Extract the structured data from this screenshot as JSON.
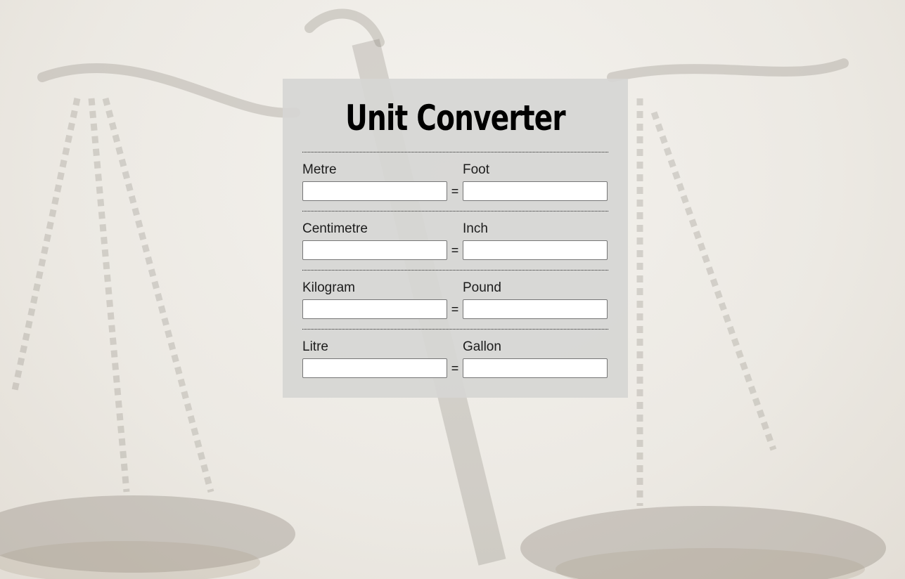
{
  "page": {
    "title": "Unit Converter"
  },
  "conversions": [
    {
      "left_label": "Metre",
      "right_label": "Foot",
      "left_value": "",
      "right_value": "",
      "separator": "="
    },
    {
      "left_label": "Centimetre",
      "right_label": "Inch",
      "left_value": "",
      "right_value": "",
      "separator": "="
    },
    {
      "left_label": "Kilogram",
      "right_label": "Pound",
      "left_value": "",
      "right_value": "",
      "separator": "="
    },
    {
      "left_label": "Litre",
      "right_label": "Gallon",
      "left_value": "",
      "right_value": "",
      "separator": "="
    }
  ],
  "colors": {
    "panel": "#d6d6d4",
    "text": "#1c1c1c",
    "title": "#000000"
  }
}
